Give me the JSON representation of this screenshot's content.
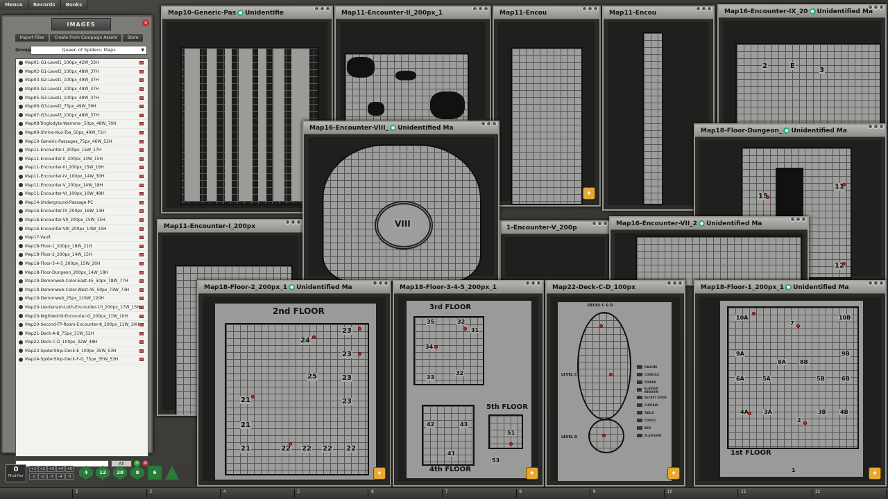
{
  "top_menu": [
    "Menus",
    "Records",
    "Books"
  ],
  "images_panel": {
    "title": "IMAGES",
    "tabs": [
      "Import Files",
      "Create From Campaign Assets",
      "Store"
    ],
    "group_label": "Group",
    "group_value": "Queen of Spiders: Maps",
    "all_button": "All",
    "items": [
      "Map01-G1-Level1_100px_42W_33H",
      "Map02-G1-Level2_100px_48W_37H",
      "Map03-G2-Level1_100px_49W_37H",
      "Map04-G2-Level2_100px_49W_37H",
      "Map05-G3-Level1_100px_49W_37H",
      "Map06-G3-Level2_75px_49W_39H",
      "Map07-G3-Level3_100px_48W_37H",
      "Map08-Troglodyte-Warrens-_50px_48W_70H",
      "Map09-Shrine-Kuo-Toa_50px_49W_71H",
      "Map10-Generic-Passages_75px_46W_52H",
      "Map11-Encounter-I_200px_15W_17H",
      "Map11-Encounter-II_200px_14W_15H",
      "Map11-Encounter-III_200px_15W_16H",
      "Map11-Encounter-IV_100px_14W_30H",
      "Map11-Encounter-V_200px_14W_18H",
      "Map11-Encounter-VI_100px_10W_48H",
      "Map14-Underground-Passage-PC",
      "Map16-Encounter-IX_200px_16W_13H",
      "Map16-Encounter-VII_200px_15W_15H",
      "Map16-Encounter-VIII_200px_14W_15H",
      "Map17-Vault",
      "Map18-Floor-1_200px_18W_21H",
      "Map18-Floor-2_200px_14W_15H",
      "Map18-Floor-3-4-5_200px_15W_20H",
      "Map18-Floor-Dungeon_200px_14W_18H",
      "Map19-Demonweb-Color-East-45_50px_78W_77H",
      "Map19-Demonweb-Color-West-45_50px_73W_73H",
      "Map19-Demonweb_25px_119W_120H",
      "Map20-Lieutenant-Loth-Encounter-10_200px_17W_15H",
      "Map20-Nightworld-Encounter-G_200px_11W_10H",
      "Map20-Second-TP-Room-Encounter-8_200px_11W_10H",
      "Map21-Deck-A-B_75px_31W_52H",
      "Map22-Deck-C-D_100px_32W_48H",
      "Map23-SpiderShip-Deck-E_100px_35W_53H",
      "Map24-SpiderShip-Deck-F-G_75px_35W_53H"
    ]
  },
  "windows": {
    "w10": {
      "title": "Map10-Generic-Pas",
      "tag": "Unidentifie"
    },
    "w11b": {
      "title": "Map11-Encounter-II_200px_1",
      "tag": ""
    },
    "w11c": {
      "title": "Map11-Encou",
      "tag": ""
    },
    "w11d": {
      "title": "Map11-Encou",
      "tag": ""
    },
    "w16ix": {
      "title": "Map16-Encounter-IX_20",
      "tag": "Unidentified Ma"
    },
    "w16viii": {
      "title": "Map16-Encounter-VIII_",
      "tag": "Unidentified Ma",
      "room_label": "VIII"
    },
    "w18dun": {
      "title": "Map18-Floor-Dungeon_",
      "tag": "Unidentified Ma"
    },
    "w11a": {
      "title": "Map11-Encounter-I_200px",
      "tag": ""
    },
    "w11v": {
      "title": "1-Encounter-V_200p",
      "tag": ""
    },
    "w16vii": {
      "title": "Map16-Encounter-VII_2",
      "tag": "Unidentified Ma"
    },
    "w18f2": {
      "title": "Map18-Floor-2_200px_1",
      "tag": "Unidentified Ma",
      "floor_label": "2nd FLOOR",
      "rooms": [
        "24",
        "23",
        "23",
        "25",
        "23",
        "23",
        "21",
        "21",
        "21",
        "22",
        "22",
        "22",
        "22"
      ]
    },
    "w18f345": {
      "title": "Map18-Floor-3-4-5_200px_1",
      "tag": "",
      "floor3": "3rd FLOOR",
      "floor4": "4th FLOOR",
      "floor5": "5th FLOOR",
      "rooms": [
        "35",
        "32",
        "31",
        "34",
        "33",
        "32",
        "42",
        "43",
        "41",
        "51",
        "53"
      ]
    },
    "w22": {
      "title": "Map22-Deck-C-D_100px",
      "tag": "",
      "deck_label": "DECKS C & D",
      "level_c": "LEVEL C",
      "level_d": "LEVEL D",
      "legend": [
        "RAILING",
        "CONSOLE",
        "POWER",
        "GLASSED WINDOW",
        "SECRET DOOR",
        "CURTAIN",
        "TABLE",
        "COUCH",
        "BED",
        "PLATFORM"
      ]
    },
    "w18f1": {
      "title": "Map18-Floor-1_200px_1",
      "tag": "Unidentified Ma",
      "floor_label": "1st FLOOR",
      "rooms": [
        "10A",
        "7",
        "10B",
        "9A",
        "8A",
        "8B",
        "9B",
        "6A",
        "5A",
        "5B",
        "6B",
        "4A",
        "3A",
        "2",
        "3B",
        "4B",
        "1"
      ]
    },
    "w16ix_rooms": [
      "2",
      "E",
      "3"
    ],
    "w18dun_rooms": [
      "15",
      "11",
      "12"
    ]
  },
  "modifier": {
    "value": "0",
    "label": "Modifier"
  },
  "mod_buttons": [
    "+1",
    "+2",
    "+3",
    "+4",
    "+5",
    "-1",
    "-2",
    "-3",
    "-4",
    "-5"
  ],
  "dice": [
    "d4",
    "d12",
    "d20",
    "d8",
    "d6",
    "d10"
  ],
  "dice_labels": [
    "4",
    "12",
    "20",
    "8",
    "6",
    ""
  ],
  "hotkeys": [
    "",
    "2",
    "3",
    "4",
    "5",
    "6",
    "7",
    "8",
    "9",
    "10",
    "11",
    "12"
  ]
}
